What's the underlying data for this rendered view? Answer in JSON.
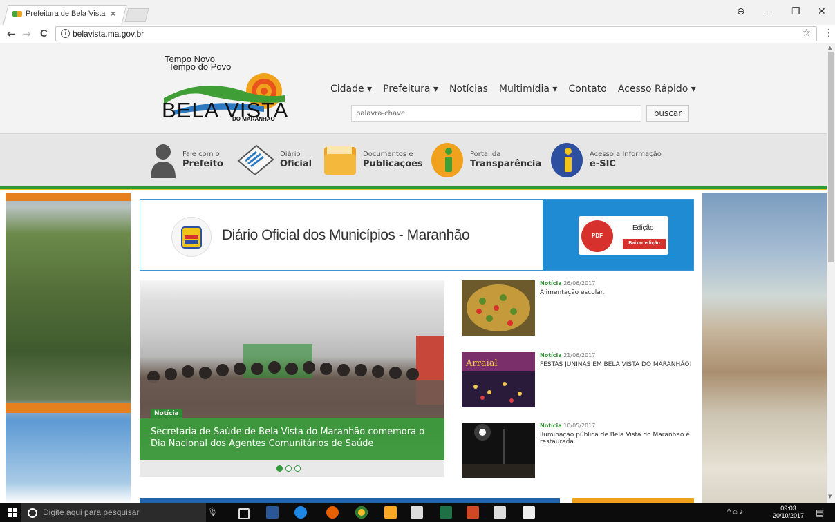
{
  "browser": {
    "tab_title": "Prefeitura de Bela Vista d",
    "tab_close": "×",
    "url": "belavista.ma.gov.br",
    "window_controls": [
      "⊖",
      "–",
      "❐",
      "✕"
    ],
    "nav": {
      "back": "←",
      "forward": "→",
      "reload": "C"
    }
  },
  "site": {
    "logo": {
      "tagline_1": "Tempo Novo",
      "tagline_2": "Tempo do Povo",
      "name": "BELA VISTA",
      "sub": "DO MARANHAO"
    },
    "menu": [
      "Cidade ▾",
      "Prefeitura ▾",
      "Notícias",
      "Multimídia ▾",
      "Contato",
      "Acesso Rápido ▾"
    ],
    "search": {
      "placeholder": "palavra-chave",
      "button": "buscar"
    },
    "quick_links": [
      {
        "line1": "Fale com o",
        "line2": "Prefeito",
        "icon": "person-icon"
      },
      {
        "line1": "Diário",
        "line2": "Oficial",
        "icon": "newspaper-icon"
      },
      {
        "line1": "Documentos e",
        "line2": "Publicações",
        "icon": "folder-icon"
      },
      {
        "line1": "Portal da",
        "line2": "Transparência",
        "icon": "info-icon"
      },
      {
        "line1": "Acesso a Informação",
        "line2": "e-SIC",
        "icon": "info-icon"
      }
    ],
    "diario": {
      "title": "Diário Oficial dos Municípios - Maranhão",
      "pdf": "PDF",
      "edition_label": "Edição",
      "download_button": "Baixar edição"
    },
    "slider": {
      "tag": "Notícia",
      "title": "Secretaria de Saúde de Bela Vista do Maranhão comemora o Dia Nacional dos Agentes Comunitários de Saúde",
      "dots": 3,
      "active_dot": 1
    },
    "news": [
      {
        "tag": "Notícia",
        "date": "26/06/2017",
        "title": "Alimentação escolar."
      },
      {
        "tag": "Notícia",
        "date": "21/06/2017",
        "title": "FESTAS JUNINAS EM BELA VISTA DO MARANHÃO!"
      },
      {
        "tag": "Notícia",
        "date": "10/05/2017",
        "title": "Iluminação pública de Bela Vista do Maranhão é restaurada."
      }
    ]
  },
  "taskbar": {
    "search_placeholder": "Digite aqui para pesquisar",
    "time": "09:03",
    "date": "20/10/2017",
    "colors": {
      "word": "#2b5797",
      "edge": "#1e88e5",
      "firefox": "#e66000",
      "chrome": "#fbc02d",
      "excel": "#1e7145",
      "powerpoint": "#d24726"
    }
  }
}
